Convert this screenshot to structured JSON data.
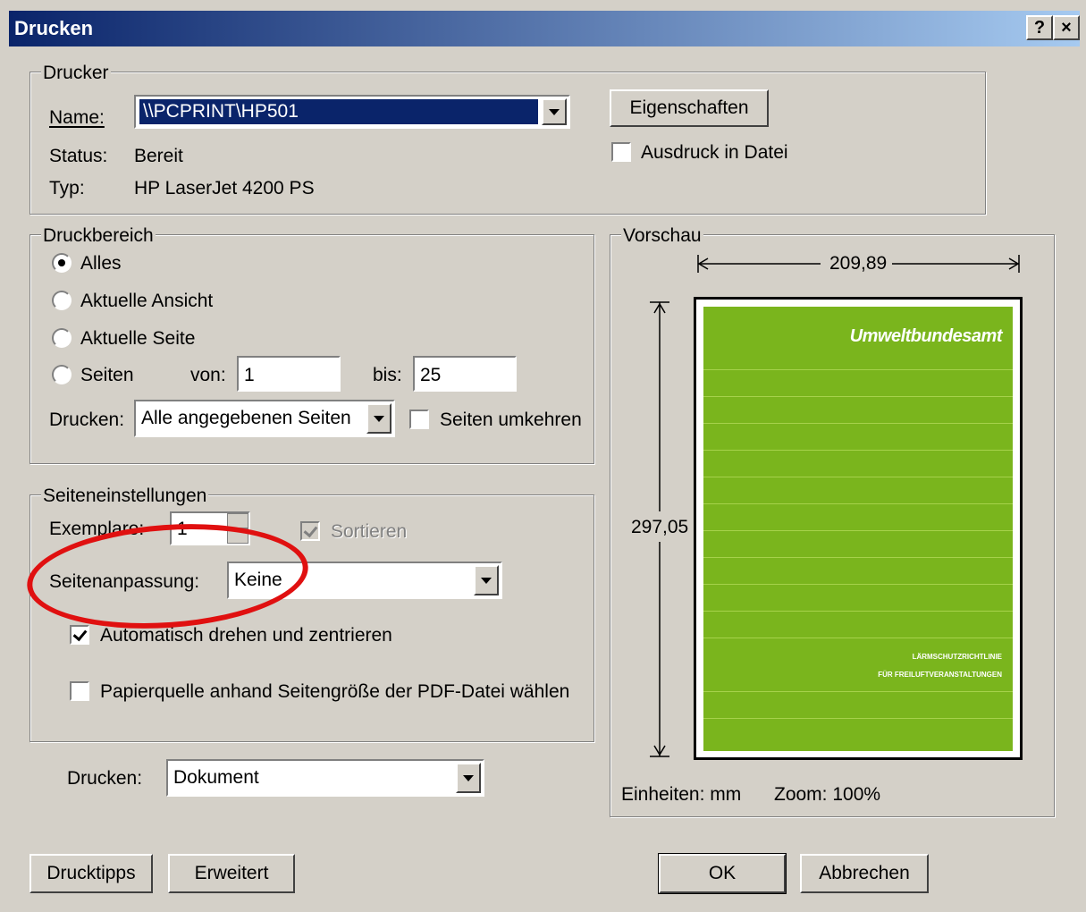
{
  "window": {
    "title": "Drucken",
    "help_btn": "?",
    "close_btn": "×"
  },
  "printer": {
    "legend": "Drucker",
    "name_label": "Name:",
    "name_value": "\\\\PCPRINT\\HP501",
    "status_label": "Status:",
    "status_value": "Bereit",
    "type_label": "Typ:",
    "type_value": "HP LaserJet 4200 PS",
    "properties_button": "Eigenschaften",
    "print_to_file": "Ausdruck in Datei"
  },
  "range": {
    "legend": "Druckbereich",
    "all": "Alles",
    "current_view": "Aktuelle Ansicht",
    "current_page": "Aktuelle Seite",
    "pages": "Seiten",
    "from_label": "von:",
    "from_value": "1",
    "to_label": "bis:",
    "to_value": "25",
    "print_label": "Drucken:",
    "print_value": "Alle angegebenen Seiten",
    "reverse": "Seiten umkehren"
  },
  "page_settings": {
    "legend": "Seiteneinstellungen",
    "copies_label": "Exemplare:",
    "copies_value": "1",
    "collate": "Sortieren",
    "scaling_label": "Seitenanpassung:",
    "scaling_value": "Keine",
    "auto_rotate": "Automatisch drehen und zentrieren",
    "paper_source": "Papierquelle anhand Seitengröße der PDF-Datei wählen"
  },
  "print_what": {
    "label": "Drucken:",
    "value": "Dokument"
  },
  "preview": {
    "legend": "Vorschau",
    "width": "209,89",
    "height": "297,05",
    "units": "Einheiten: mm",
    "zoom": "Zoom: 100%",
    "cover_brand": "Umweltbundesamt",
    "cover_line1": "LÄRMSCHUTZRICHTLINIE",
    "cover_line2": "FÜR FREILUFTVERANSTALTUNGEN",
    "cover_color": "#7ab51d"
  },
  "buttons": {
    "tips": "Drucktipps",
    "advanced": "Erweitert",
    "ok": "OK",
    "cancel": "Abbrechen"
  }
}
